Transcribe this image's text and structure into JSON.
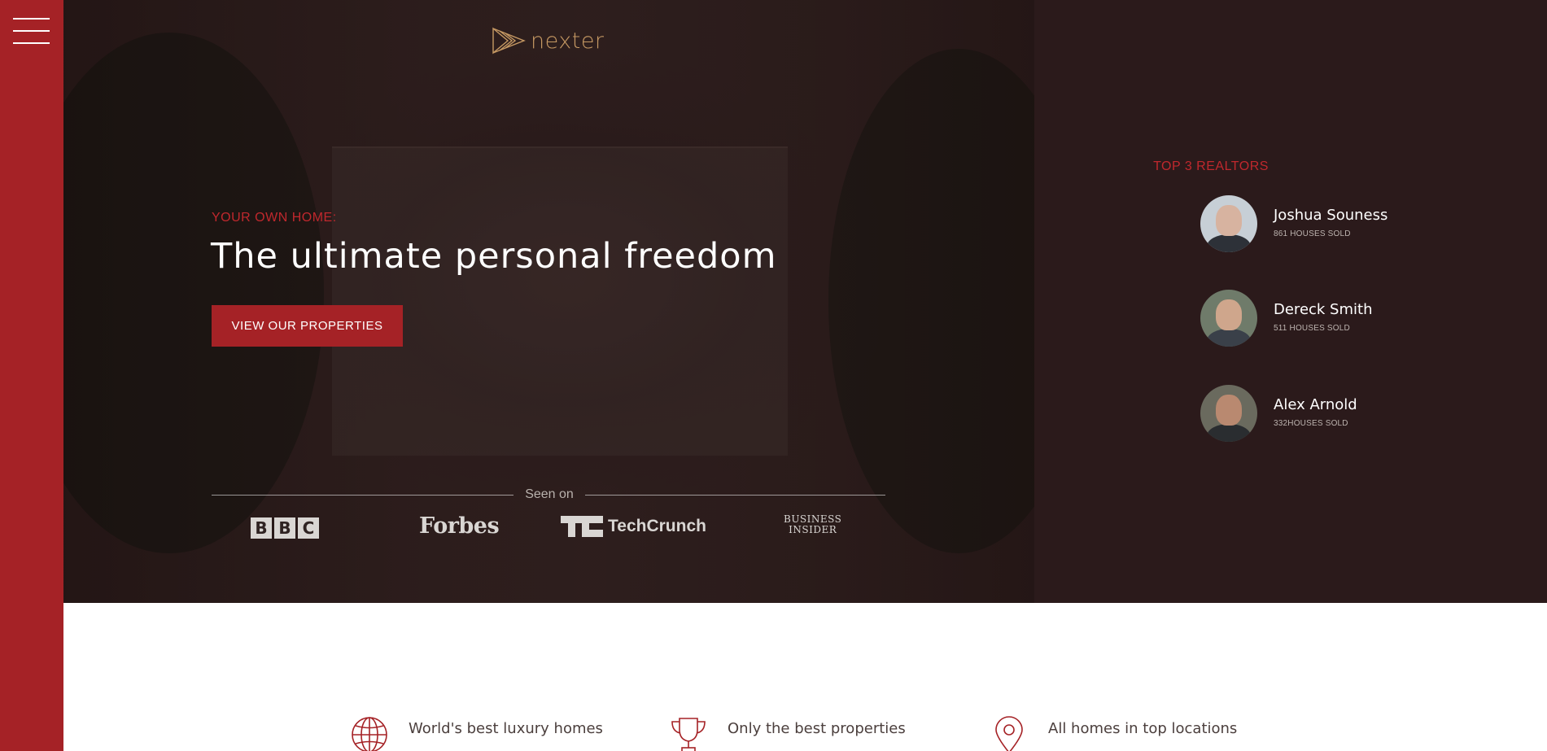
{
  "brand": {
    "name": "nexter",
    "logo_color": "#c69963",
    "accent_color": "#a52226"
  },
  "sidebar": {
    "menu_icon": "hamburger-menu-icon"
  },
  "hero": {
    "subtitle": "YOUR OWN HOME:",
    "title": "The ultimate personal freedom",
    "cta_label": "VIEW OUR PROPERTIES",
    "seen_on_label": "Seen on",
    "press": [
      {
        "name": "BBC",
        "letters": [
          "B",
          "B",
          "C"
        ]
      },
      {
        "name": "Forbes"
      },
      {
        "name": "TechCrunch"
      },
      {
        "name": "Business Insider",
        "line1": "BUSINESS",
        "line2": "INSIDER"
      }
    ]
  },
  "realtors": {
    "title": "TOP 3 REALTORS",
    "items": [
      {
        "name": "Joshua Souness",
        "sold": "861 HOUSES SOLD"
      },
      {
        "name": "Dereck Smith",
        "sold": "511 HOUSES SOLD"
      },
      {
        "name": "Alex Arnold",
        "sold": "332HOUSES SOLD"
      }
    ]
  },
  "features": [
    {
      "icon": "globe-icon",
      "label": "World's best luxury homes"
    },
    {
      "icon": "trophy-icon",
      "label": "Only the best properties"
    },
    {
      "icon": "map-pin-icon",
      "label": "All homes in top locations"
    }
  ]
}
